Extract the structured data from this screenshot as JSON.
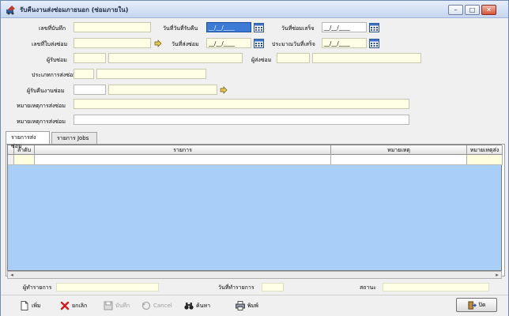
{
  "window": {
    "title": "รับคืนงานส่งซ่อมภายนอก (ซ่อมภายใน)",
    "minimize": "–",
    "maximize": "□",
    "close": "✕"
  },
  "form": {
    "record_no_label": "เลขที่บันทึก",
    "receive_date_label": "วันที่วันที่รับคืน",
    "receive_date_value": "__/__/____",
    "repair_done_label": "วันที่ซ่อมเสร็จ",
    "repair_done_value": "__/__/____",
    "repair_slip_label": "เลขที่ใบส่งซ่อม",
    "sent_date_label": "วันที่ส่งซ่อม",
    "sent_date_value": "__/__/____",
    "estimated_done_label": "ประมาณวันที่เสร็จ",
    "estimated_done_value": "__/__/____",
    "repairer_label": "ผู้รับซ่อม",
    "sender_label": "ผู้ส่งซ่อม",
    "repair_type_label": "ประเภทการส่งซ่อม",
    "receiver_label": "ผู้รับคืนงานซ่อม",
    "note1_label": "หมายเหตุการส่งซ่อม",
    "note2_label": "หมายเหตุการส่งซ่อม"
  },
  "tabs": [
    {
      "label": "รายการส่งซ่อม"
    },
    {
      "label": "รายการ Jobs"
    }
  ],
  "grid": {
    "columns": [
      "ลำดับ",
      "รายการ",
      "หมายเหตุ",
      "หมายเหตุส่ง"
    ]
  },
  "footer": {
    "created_by_label": "ผู้ทำรายการ",
    "created_date_label": "วันที่ทำรายการ",
    "status_label": "สถานะ"
  },
  "toolbar": {
    "add": "เพิ่ม",
    "cancel_th": "ยกเลิก",
    "save": "บันทึก",
    "cancel": "Cancel",
    "search": "ค้นหา",
    "print": "พิมพ์",
    "close": "ปิด"
  }
}
